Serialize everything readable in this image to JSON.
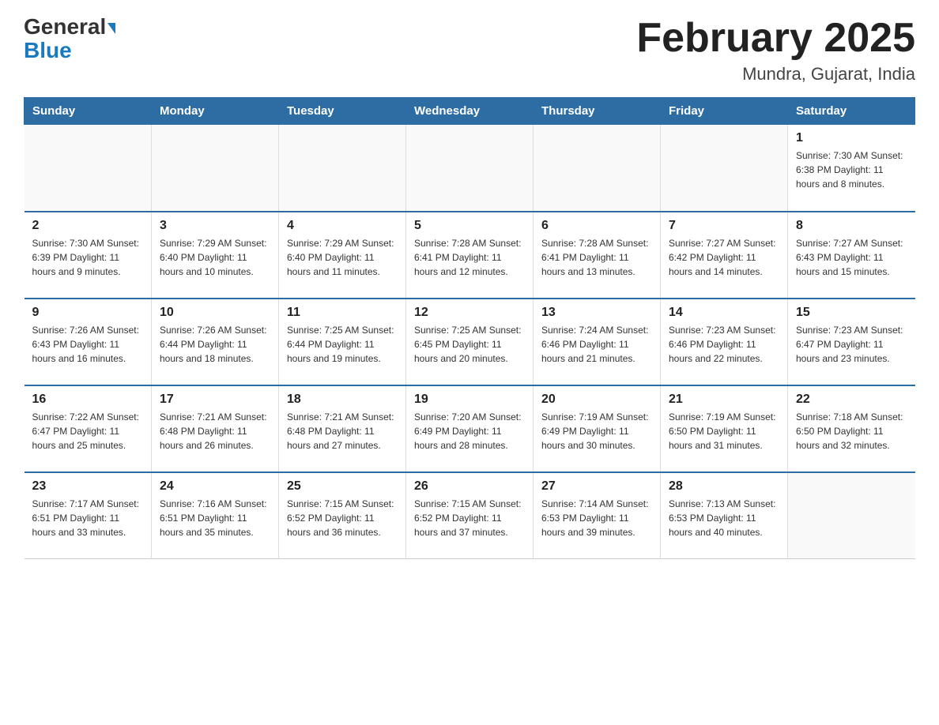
{
  "header": {
    "logo_general": "General",
    "logo_blue": "Blue",
    "month_title": "February 2025",
    "location": "Mundra, Gujarat, India"
  },
  "days_of_week": [
    "Sunday",
    "Monday",
    "Tuesday",
    "Wednesday",
    "Thursday",
    "Friday",
    "Saturday"
  ],
  "weeks": [
    [
      {
        "day": "",
        "info": ""
      },
      {
        "day": "",
        "info": ""
      },
      {
        "day": "",
        "info": ""
      },
      {
        "day": "",
        "info": ""
      },
      {
        "day": "",
        "info": ""
      },
      {
        "day": "",
        "info": ""
      },
      {
        "day": "1",
        "info": "Sunrise: 7:30 AM\nSunset: 6:38 PM\nDaylight: 11 hours and 8 minutes."
      }
    ],
    [
      {
        "day": "2",
        "info": "Sunrise: 7:30 AM\nSunset: 6:39 PM\nDaylight: 11 hours and 9 minutes."
      },
      {
        "day": "3",
        "info": "Sunrise: 7:29 AM\nSunset: 6:40 PM\nDaylight: 11 hours and 10 minutes."
      },
      {
        "day": "4",
        "info": "Sunrise: 7:29 AM\nSunset: 6:40 PM\nDaylight: 11 hours and 11 minutes."
      },
      {
        "day": "5",
        "info": "Sunrise: 7:28 AM\nSunset: 6:41 PM\nDaylight: 11 hours and 12 minutes."
      },
      {
        "day": "6",
        "info": "Sunrise: 7:28 AM\nSunset: 6:41 PM\nDaylight: 11 hours and 13 minutes."
      },
      {
        "day": "7",
        "info": "Sunrise: 7:27 AM\nSunset: 6:42 PM\nDaylight: 11 hours and 14 minutes."
      },
      {
        "day": "8",
        "info": "Sunrise: 7:27 AM\nSunset: 6:43 PM\nDaylight: 11 hours and 15 minutes."
      }
    ],
    [
      {
        "day": "9",
        "info": "Sunrise: 7:26 AM\nSunset: 6:43 PM\nDaylight: 11 hours and 16 minutes."
      },
      {
        "day": "10",
        "info": "Sunrise: 7:26 AM\nSunset: 6:44 PM\nDaylight: 11 hours and 18 minutes."
      },
      {
        "day": "11",
        "info": "Sunrise: 7:25 AM\nSunset: 6:44 PM\nDaylight: 11 hours and 19 minutes."
      },
      {
        "day": "12",
        "info": "Sunrise: 7:25 AM\nSunset: 6:45 PM\nDaylight: 11 hours and 20 minutes."
      },
      {
        "day": "13",
        "info": "Sunrise: 7:24 AM\nSunset: 6:46 PM\nDaylight: 11 hours and 21 minutes."
      },
      {
        "day": "14",
        "info": "Sunrise: 7:23 AM\nSunset: 6:46 PM\nDaylight: 11 hours and 22 minutes."
      },
      {
        "day": "15",
        "info": "Sunrise: 7:23 AM\nSunset: 6:47 PM\nDaylight: 11 hours and 23 minutes."
      }
    ],
    [
      {
        "day": "16",
        "info": "Sunrise: 7:22 AM\nSunset: 6:47 PM\nDaylight: 11 hours and 25 minutes."
      },
      {
        "day": "17",
        "info": "Sunrise: 7:21 AM\nSunset: 6:48 PM\nDaylight: 11 hours and 26 minutes."
      },
      {
        "day": "18",
        "info": "Sunrise: 7:21 AM\nSunset: 6:48 PM\nDaylight: 11 hours and 27 minutes."
      },
      {
        "day": "19",
        "info": "Sunrise: 7:20 AM\nSunset: 6:49 PM\nDaylight: 11 hours and 28 minutes."
      },
      {
        "day": "20",
        "info": "Sunrise: 7:19 AM\nSunset: 6:49 PM\nDaylight: 11 hours and 30 minutes."
      },
      {
        "day": "21",
        "info": "Sunrise: 7:19 AM\nSunset: 6:50 PM\nDaylight: 11 hours and 31 minutes."
      },
      {
        "day": "22",
        "info": "Sunrise: 7:18 AM\nSunset: 6:50 PM\nDaylight: 11 hours and 32 minutes."
      }
    ],
    [
      {
        "day": "23",
        "info": "Sunrise: 7:17 AM\nSunset: 6:51 PM\nDaylight: 11 hours and 33 minutes."
      },
      {
        "day": "24",
        "info": "Sunrise: 7:16 AM\nSunset: 6:51 PM\nDaylight: 11 hours and 35 minutes."
      },
      {
        "day": "25",
        "info": "Sunrise: 7:15 AM\nSunset: 6:52 PM\nDaylight: 11 hours and 36 minutes."
      },
      {
        "day": "26",
        "info": "Sunrise: 7:15 AM\nSunset: 6:52 PM\nDaylight: 11 hours and 37 minutes."
      },
      {
        "day": "27",
        "info": "Sunrise: 7:14 AM\nSunset: 6:53 PM\nDaylight: 11 hours and 39 minutes."
      },
      {
        "day": "28",
        "info": "Sunrise: 7:13 AM\nSunset: 6:53 PM\nDaylight: 11 hours and 40 minutes."
      },
      {
        "day": "",
        "info": ""
      }
    ]
  ]
}
